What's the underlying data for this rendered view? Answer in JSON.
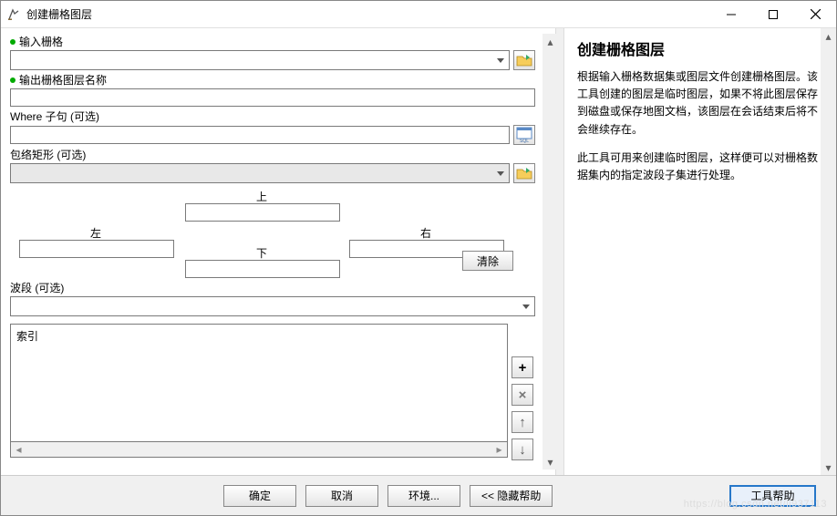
{
  "window": {
    "title": "创建栅格图层"
  },
  "fields": {
    "input_raster_label": "输入栅格",
    "output_name_label": "输出栅格图层名称",
    "where_label": "Where 子句 (可选)",
    "envelope_label": "包络矩形 (可选)",
    "top_label": "上",
    "left_label": "左",
    "right_label": "右",
    "bottom_label": "下",
    "clear_label": "清除",
    "bands_label": "波段 (可选)",
    "list_item0": "索引"
  },
  "side": {
    "add": "+",
    "remove": "×",
    "up": "↑",
    "down": "↓"
  },
  "footer": {
    "ok": "确定",
    "cancel": "取消",
    "env": "环境...",
    "hidehelp": "<< 隐藏帮助",
    "toolhelp": "工具帮助"
  },
  "help": {
    "title": "创建栅格图层",
    "p1": "根据输入栅格数据集或图层文件创建栅格图层。该工具创建的图层是临时图层，如果不将此图层保存到磁盘或保存地图文档，该图层在会话结束后将不会继续存在。",
    "p2": "此工具可用来创建临时图层，这样便可以对栅格数据集内的指定波段子集进行处理。"
  },
  "watermark": "https://blog.csdn.net/li937113"
}
